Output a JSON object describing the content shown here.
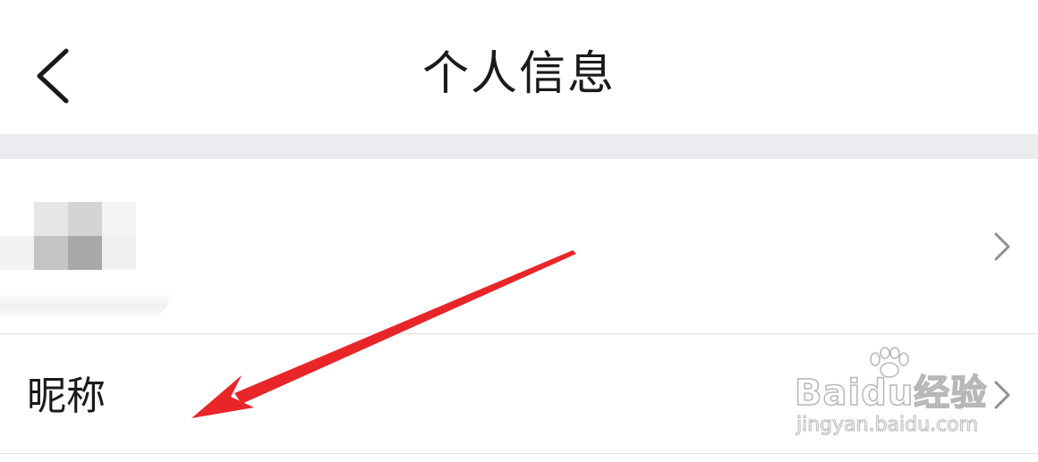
{
  "header": {
    "title": "个人信息",
    "back_icon": "chevron-left-icon"
  },
  "rows": {
    "avatar": {
      "chevron_icon": "chevron-right-icon"
    },
    "nickname": {
      "label": "昵称",
      "chevron_icon": "chevron-right-icon"
    }
  },
  "watermark": {
    "logo_text": "Baidu经验",
    "url": "jingyan.baidu.com"
  },
  "annotation": {
    "arrow_color": "#e8262a"
  },
  "colors": {
    "background": "#ffffff",
    "section_gap": "#ebebf0",
    "divider": "#dcdcdc",
    "text_primary": "#1a1a1a",
    "chevron": "#8e8e93"
  }
}
